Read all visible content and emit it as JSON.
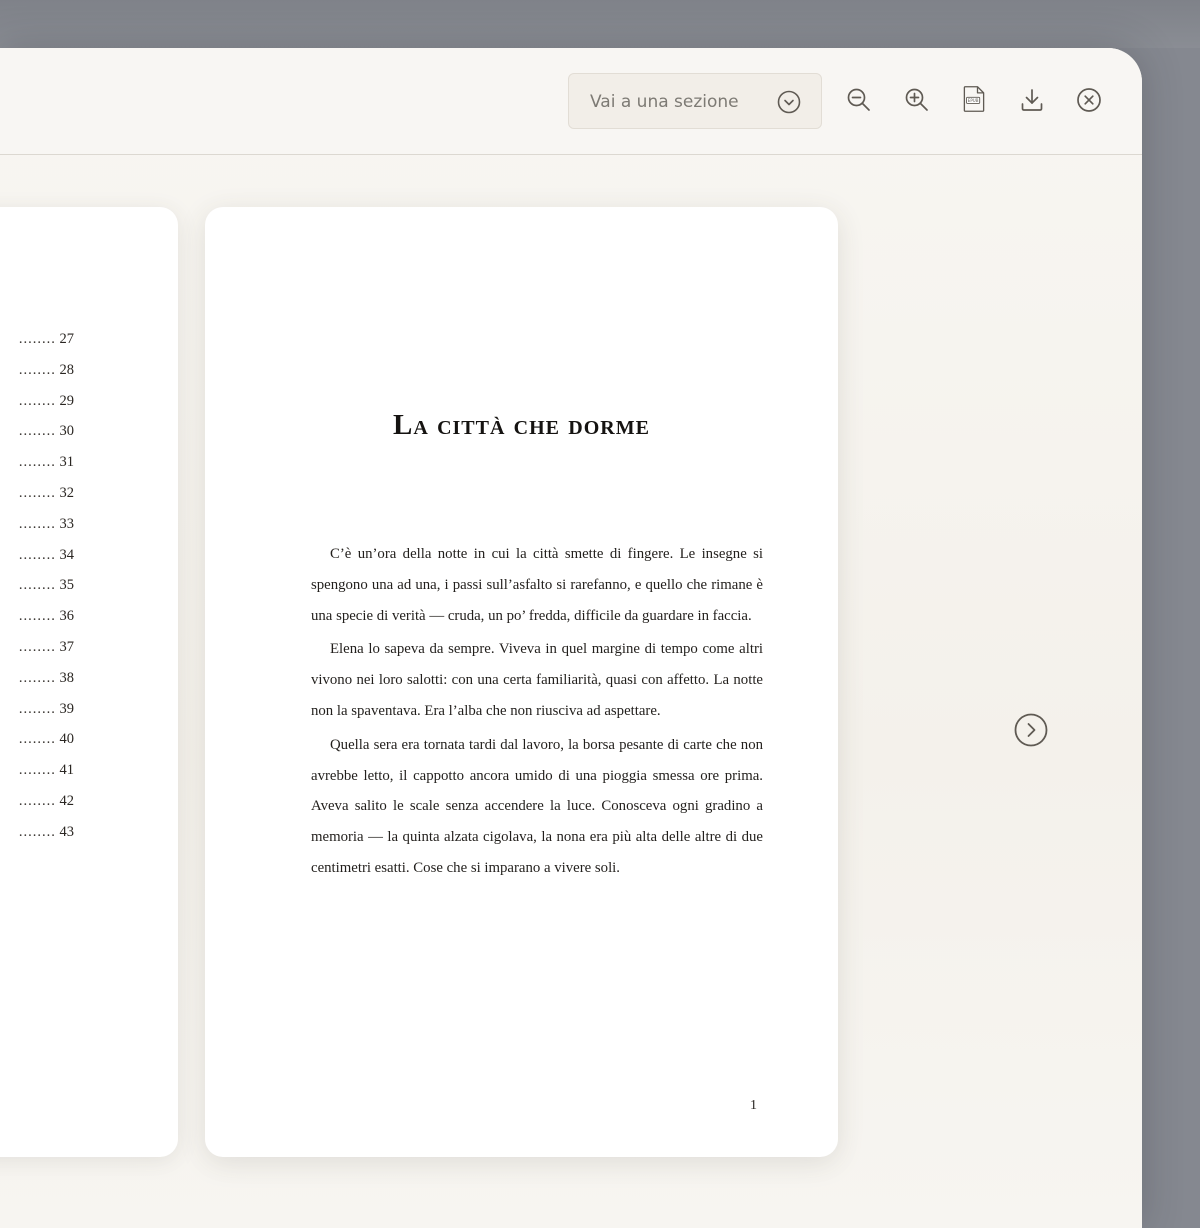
{
  "toolbar": {
    "section_placeholder": "Vai a una sezione",
    "icons": {
      "section_dropdown": "chevron-down-circle-icon",
      "zoom_out": "zoom-out-icon",
      "zoom_in": "zoom-in-icon",
      "epub": "epub-file-icon",
      "download": "download-icon",
      "close": "close-circle-icon"
    },
    "epub_label": "EPUB"
  },
  "left_page": {
    "toc_entries": [
      {
        "dots": "........",
        "page": "27"
      },
      {
        "dots": "........",
        "page": "28"
      },
      {
        "dots": "........",
        "page": "29"
      },
      {
        "dots": "........",
        "page": "30"
      },
      {
        "dots": "........",
        "page": "31"
      },
      {
        "dots": "........",
        "page": "32"
      },
      {
        "dots": "........",
        "page": "33"
      },
      {
        "dots": "........",
        "page": "34"
      },
      {
        "dots": "........",
        "page": "35"
      },
      {
        "dots": "........",
        "page": "36"
      },
      {
        "dots": "........",
        "page": "37"
      },
      {
        "dots": "........",
        "page": "38"
      },
      {
        "dots": "........",
        "page": "39"
      },
      {
        "dots": "........",
        "page": "40"
      },
      {
        "dots": "........",
        "page": "41"
      },
      {
        "dots": "........",
        "page": "42"
      },
      {
        "dots": "........",
        "page": "43"
      }
    ]
  },
  "right_page": {
    "chapter_title": "La città che dorme",
    "paragraphs": [
      "C’è un’ora della notte in cui la città smette di fingere. Le insegne si spengono una ad una, i passi sull’asfalto si rarefanno, e quello che rimane è una specie di verità — cruda, un po’ fredda, difficile da guardare in faccia.",
      "Elena lo sapeva da sempre. Viveva in quel margine di tempo come altri vivono nei loro salotti: con una certa familiarità, quasi con affetto. La notte non la spaventava. Era l’alba che non riusciva ad aspettare.",
      "Quella sera era tornata tardi dal lavoro, la borsa pesante di carte che non avrebbe letto, il cappotto ancora umido di una pioggia smessa ore prima. Aveva salito le scale senza accendere la luce. Conosceva ogni gradino a memoria — la quinta alzata cigolava, la nona era più alta delle altre di due centimetri esatti. Cose che si imparano a vivere soli."
    ],
    "page_number": "1"
  },
  "navigation": {
    "next_icon": "chevron-right-circle-icon"
  },
  "colors": {
    "backdrop": "#858890",
    "window": "#f6f3ee",
    "page": "#ffffff",
    "icon": "#5f5a53",
    "text": "#221f1c"
  }
}
